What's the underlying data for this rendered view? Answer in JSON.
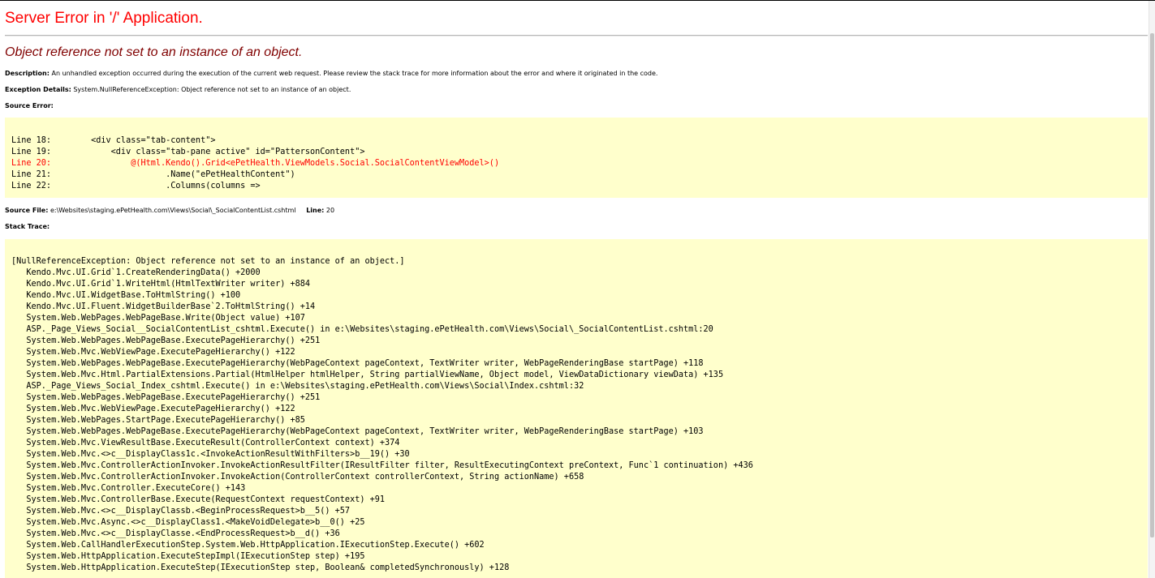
{
  "title": "Server Error in '/' Application.",
  "error_message": "Object reference not set to an instance of an object.",
  "description": {
    "label": "Description:",
    "text": "An unhandled exception occurred during the execution of the current web request. Please review the stack trace for more information about the error and where it originated in the code."
  },
  "exception_details": {
    "label": "Exception Details:",
    "text": "System.NullReferenceException: Object reference not set to an instance of an object."
  },
  "source_error": {
    "label": "Source Error:",
    "lines": [
      {
        "text": "Line 18:        <div class=\"tab-content\">",
        "highlight": false
      },
      {
        "text": "Line 19:            <div class=\"tab-pane active\" id=\"PattersonContent\">",
        "highlight": false
      },
      {
        "text": "Line 20:                @(Html.Kendo().Grid<ePetHealth.ViewModels.Social.SocialContentViewModel>()",
        "highlight": true
      },
      {
        "text": "Line 21:                       .Name(\"ePetHealthContent\")",
        "highlight": false
      },
      {
        "text": "Line 22:                       .Columns(columns =>",
        "highlight": false
      }
    ]
  },
  "source_file": {
    "label": "Source File:",
    "path": "e:\\Websites\\staging.ePetHealth.com\\Views\\Social\\_SocialContentList.cshtml",
    "line_label": "Line:",
    "line_number": "20"
  },
  "stack_trace": {
    "label": "Stack Trace:",
    "lines": [
      "[NullReferenceException: Object reference not set to an instance of an object.]",
      "   Kendo.Mvc.UI.Grid`1.CreateRenderingData() +2000",
      "   Kendo.Mvc.UI.Grid`1.WriteHtml(HtmlTextWriter writer) +884",
      "   Kendo.Mvc.UI.WidgetBase.ToHtmlString() +100",
      "   Kendo.Mvc.UI.Fluent.WidgetBuilderBase`2.ToHtmlString() +14",
      "   System.Web.WebPages.WebPageBase.Write(Object value) +107",
      "   ASP._Page_Views_Social__SocialContentList_cshtml.Execute() in e:\\Websites\\staging.ePetHealth.com\\Views\\Social\\_SocialContentList.cshtml:20",
      "   System.Web.WebPages.WebPageBase.ExecutePageHierarchy() +251",
      "   System.Web.Mvc.WebViewPage.ExecutePageHierarchy() +122",
      "   System.Web.WebPages.WebPageBase.ExecutePageHierarchy(WebPageContext pageContext, TextWriter writer, WebPageRenderingBase startPage) +118",
      "   System.Web.Mvc.Html.PartialExtensions.Partial(HtmlHelper htmlHelper, String partialViewName, Object model, ViewDataDictionary viewData) +135",
      "   ASP._Page_Views_Social_Index_cshtml.Execute() in e:\\Websites\\staging.ePetHealth.com\\Views\\Social\\Index.cshtml:32",
      "   System.Web.WebPages.WebPageBase.ExecutePageHierarchy() +251",
      "   System.Web.Mvc.WebViewPage.ExecutePageHierarchy() +122",
      "   System.Web.WebPages.StartPage.ExecutePageHierarchy() +85",
      "   System.Web.WebPages.WebPageBase.ExecutePageHierarchy(WebPageContext pageContext, TextWriter writer, WebPageRenderingBase startPage) +103",
      "   System.Web.Mvc.ViewResultBase.ExecuteResult(ControllerContext context) +374",
      "   System.Web.Mvc.<>c__DisplayClass1c.<InvokeActionResultWithFilters>b__19() +30",
      "   System.Web.Mvc.ControllerActionInvoker.InvokeActionResultFilter(IResultFilter filter, ResultExecutingContext preContext, Func`1 continuation) +436",
      "   System.Web.Mvc.ControllerActionInvoker.InvokeAction(ControllerContext controllerContext, String actionName) +658",
      "   System.Web.Mvc.Controller.ExecuteCore() +143",
      "   System.Web.Mvc.ControllerBase.Execute(RequestContext requestContext) +91",
      "   System.Web.Mvc.<>c__DisplayClassb.<BeginProcessRequest>b__5() +57",
      "   System.Web.Mvc.Async.<>c__DisplayClass1.<MakeVoidDelegate>b__0() +25",
      "   System.Web.Mvc.<>c__DisplayClasse.<EndProcessRequest>b__d() +36",
      "   System.Web.CallHandlerExecutionStep.System.Web.HttpApplication.IExecutionStep.Execute() +602",
      "   System.Web.HttpApplication.ExecuteStepImpl(IExecutionStep step) +195",
      "   System.Web.HttpApplication.ExecuteStep(IExecutionStep step, Boolean& completedSynchronously) +128"
    ]
  },
  "colors": {
    "title": "#ff0000",
    "error_message": "#800000",
    "code_background": "#ffffcc",
    "highlight_line": "#ff0000"
  }
}
